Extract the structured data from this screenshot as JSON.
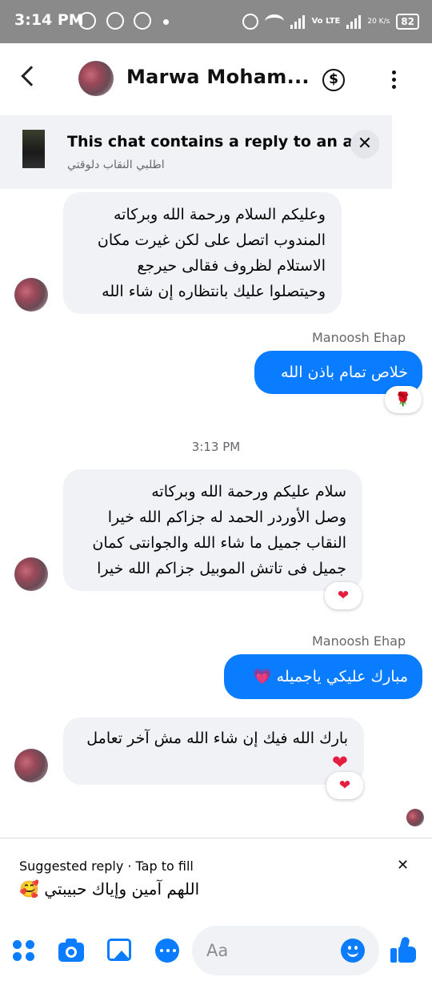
{
  "status_bar": {
    "time": "3:14 PM",
    "network": "Vo LTE",
    "speed": "20 K/s",
    "battery": "82"
  },
  "header": {
    "contact_name": "Marwa Moham...",
    "back_icon": "chevron-left-icon",
    "payment_icon": "dollar-icon",
    "menu_icon": "more-vertical-icon"
  },
  "ad_banner": {
    "title": "This chat contains a reply to an ad.",
    "subtitle": "اطلبي النقاب دلوقتي"
  },
  "messages": [
    {
      "direction": "incoming",
      "lines": [
        "وعليكم السلام ورحمة الله وبركاته",
        "المندوب اتصل على لكن غيرت مكان",
        "الاستلام لظروف فقالى حيرجع",
        "وحيتصلوا عليك بانتظاره  إن شاء الله"
      ]
    },
    {
      "direction": "outgoing",
      "sender": "Manoosh Ehap",
      "text": "خلاص تمام باذن الله",
      "reaction": "🌹"
    },
    {
      "timestamp": "3:13 PM"
    },
    {
      "direction": "incoming",
      "lines": [
        "سلام عليكم ورحمة الله وبركاته",
        "وصل الأوردر الحمد له جزاكم الله خيرا",
        "النقاب جميل ما شاء الله والجوانتى كمان",
        "جميل فى تاتش الموبيل جزاكم الله خيرا"
      ],
      "reaction": "❤"
    },
    {
      "direction": "outgoing",
      "sender": "Manoosh Ehap",
      "text": "مبارك عليكي ياجميله",
      "emoji": "💗"
    },
    {
      "direction": "incoming",
      "text": "بارك الله فيك إن شاء الله مش آخر تعامل",
      "emoji": "❤",
      "reaction": "❤"
    }
  ],
  "suggested_reply": {
    "label": "Suggested reply · Tap to fill",
    "text": "اللهم آمين وإياك حبيبتي 🥰",
    "close": "✕"
  },
  "composer": {
    "placeholder": "Aa",
    "icons": [
      "grid-menu-icon",
      "camera-icon",
      "gallery-icon",
      "chat-bubble-icon",
      "emoji-icon",
      "like-icon"
    ],
    "accent_color": "#0a7cff"
  }
}
